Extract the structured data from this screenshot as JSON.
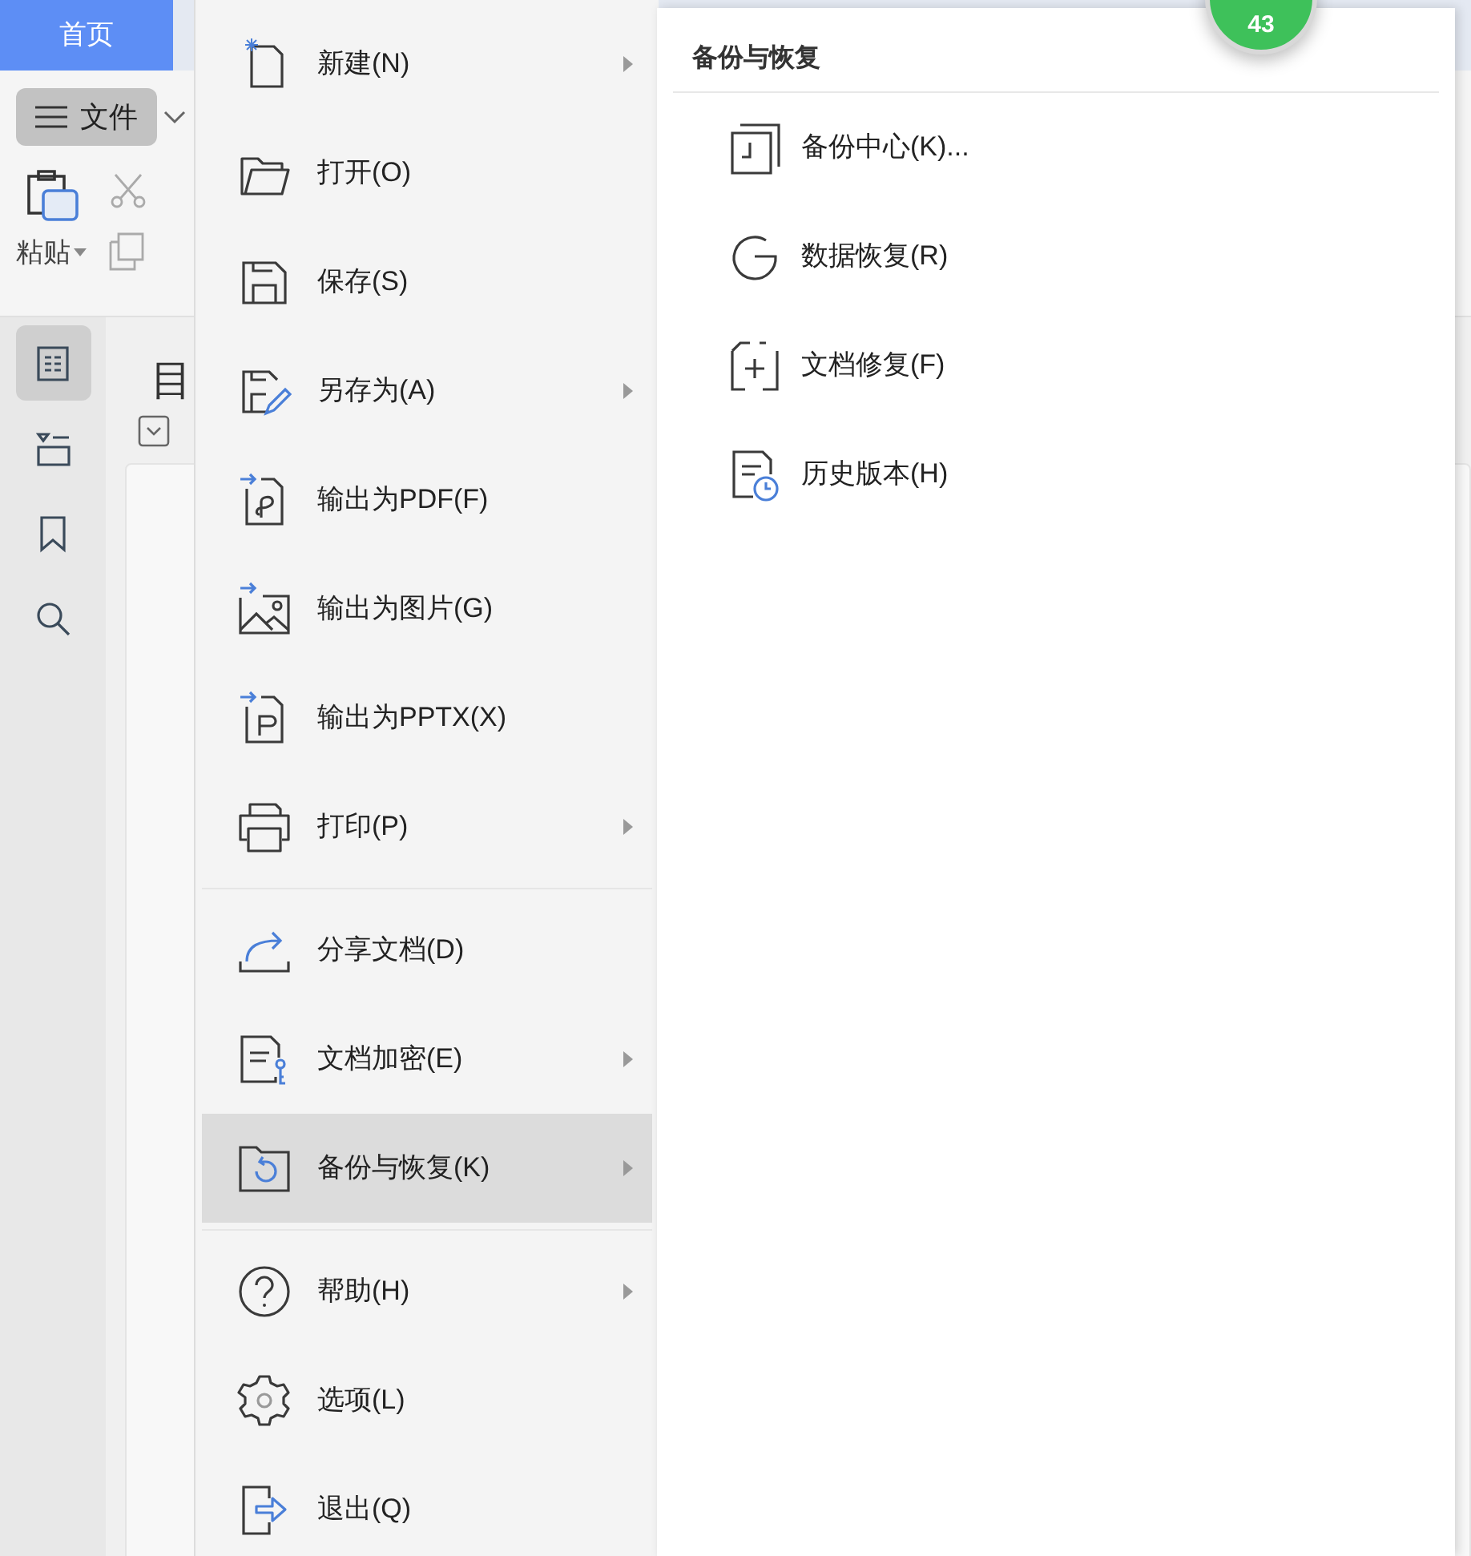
{
  "top_tab": {
    "label": "首页",
    "selected": true
  },
  "file_button": {
    "label": "文件"
  },
  "paste_button": {
    "label": "粘贴"
  },
  "sidebar": {
    "items": [
      {
        "selected": true
      },
      {
        "selected": false
      },
      {
        "selected": false
      },
      {
        "selected": false
      }
    ]
  },
  "outline_heading": "目",
  "badge": "43",
  "menu": {
    "groups": [
      [
        {
          "label": "新建(N)",
          "submenu": true,
          "selected": false
        },
        {
          "label": "打开(O)",
          "submenu": false,
          "selected": false
        },
        {
          "label": "保存(S)",
          "submenu": false,
          "selected": false
        },
        {
          "label": "另存为(A)",
          "submenu": true,
          "selected": false
        },
        {
          "label": "输出为PDF(F)",
          "submenu": false,
          "selected": false
        },
        {
          "label": "输出为图片(G)",
          "submenu": false,
          "selected": false
        },
        {
          "label": "输出为PPTX(X)",
          "submenu": false,
          "selected": false
        },
        {
          "label": "打印(P)",
          "submenu": true,
          "selected": false
        }
      ],
      [
        {
          "label": "分享文档(D)",
          "submenu": false,
          "selected": false
        },
        {
          "label": "文档加密(E)",
          "submenu": true,
          "selected": false
        },
        {
          "label": "备份与恢复(K)",
          "submenu": true,
          "selected": true
        }
      ],
      [
        {
          "label": "帮助(H)",
          "submenu": true,
          "selected": false
        },
        {
          "label": "选项(L)",
          "submenu": false,
          "selected": false
        },
        {
          "label": "退出(Q)",
          "submenu": false,
          "selected": false
        }
      ]
    ]
  },
  "submenu": {
    "title": "备份与恢复",
    "items": [
      {
        "label": "备份中心(K)..."
      },
      {
        "label": "数据恢复(R)"
      },
      {
        "label": "文档修复(F)"
      },
      {
        "label": "历史版本(H)"
      }
    ]
  }
}
